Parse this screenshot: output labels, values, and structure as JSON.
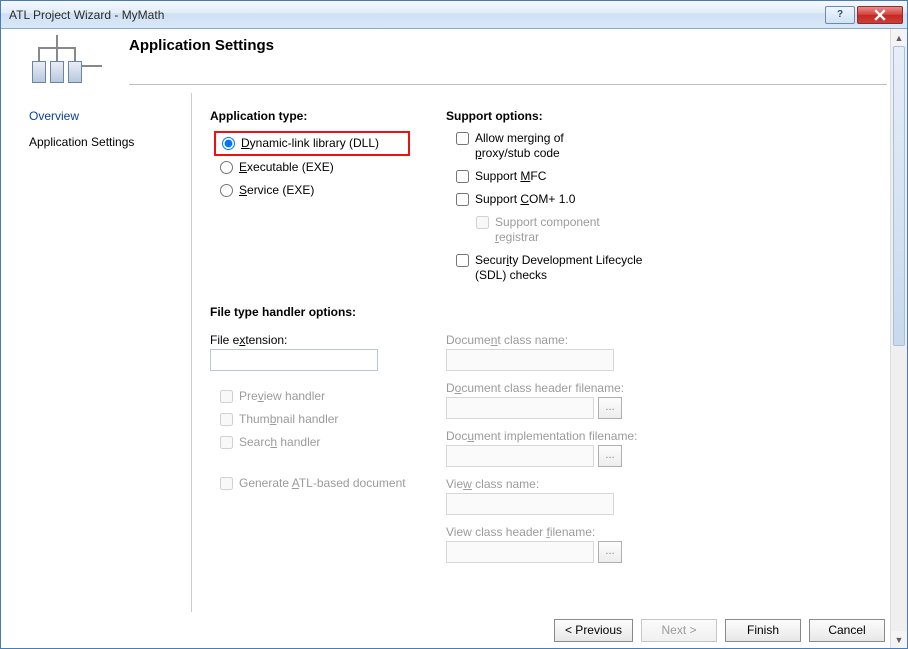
{
  "window": {
    "title": "ATL Project Wizard - MyMath"
  },
  "header": {
    "page_title": "Application Settings"
  },
  "sidebar": {
    "items": [
      {
        "label": "Overview"
      },
      {
        "label": "Application Settings"
      }
    ]
  },
  "app_type": {
    "heading": "Application type:",
    "options": {
      "dll_pre": "D",
      "dll_rest": "ynamic-link library (DLL)",
      "exe_pre": "E",
      "exe_rest": "xecutable (EXE)",
      "svc_pre": "S",
      "svc_rest": "ervice (EXE)"
    }
  },
  "support": {
    "heading": "Support options:",
    "merge_pre": "Allow merging of ",
    "merge_u": "p",
    "merge_post": "roxy/stub code",
    "mfc_pre": "Support ",
    "mfc_u": "M",
    "mfc_post": "FC",
    "com_pre": "Support ",
    "com_u": "C",
    "com_post": "OM+ 1.0",
    "compreg_pre": "Support component ",
    "compreg_u": "r",
    "compreg_post": "egistrar",
    "sdl_pre": "Secur",
    "sdl_u": "i",
    "sdl_post": "ty Development Lifecycle (SDL) checks"
  },
  "file_handler": {
    "heading": "File type handler options:",
    "ext_pre": "File e",
    "ext_u": "x",
    "ext_post": "tension:",
    "preview_pre": "Pre",
    "preview_u": "v",
    "preview_post": "iew handler",
    "thumb_pre": "Thum",
    "thumb_u": "b",
    "thumb_post": "nail handler",
    "search_pre": "Searc",
    "search_u": "h",
    "search_post": " handler",
    "gen_pre": "Generate ",
    "gen_u": "A",
    "gen_post": "TL-based document",
    "doc_class_pre": "Docume",
    "doc_class_u": "n",
    "doc_class_post": "t class name:",
    "doc_hdr_pre": "D",
    "doc_hdr_u": "o",
    "doc_hdr_post": "cument class header filename:",
    "doc_impl_pre": "Doc",
    "doc_impl_u": "u",
    "doc_impl_post": "ment implementation filename:",
    "view_class_pre": "Vie",
    "view_class_u": "w",
    "view_class_post": " class name:",
    "view_hdr_pre": "View class header ",
    "view_hdr_u": "f",
    "view_hdr_post": "ilename:"
  },
  "footer": {
    "previous": "< Previous",
    "next": "Next >",
    "finish": "Finish",
    "cancel": "Cancel"
  }
}
